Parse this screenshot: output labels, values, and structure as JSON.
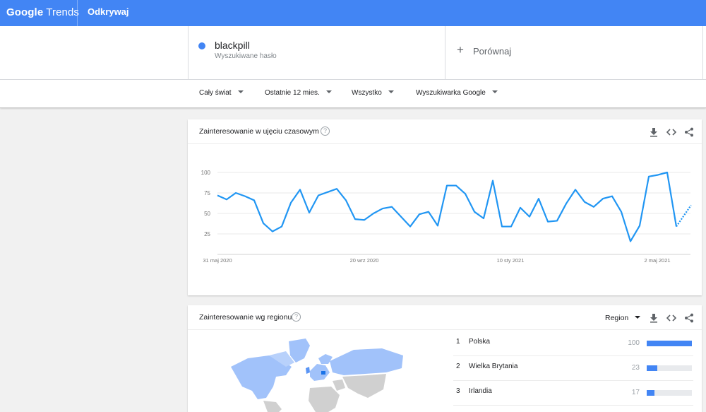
{
  "header": {
    "logo_google": "Google",
    "logo_trends": "Trends",
    "nav_label": "Odkrywaj"
  },
  "search_term": {
    "name": "blackpill",
    "subtitle": "Wyszukiwane hasło",
    "color": "#4285f4"
  },
  "compare": {
    "icon": "plus-icon",
    "label": "Porównaj"
  },
  "filters": {
    "location": "Cały świat",
    "time_range": "Ostatnie 12 mies.",
    "category": "Wszystko",
    "source": "Wyszukiwarka Google"
  },
  "time_card": {
    "title": "Zainteresowanie w ujęciu czasowym",
    "help_icon": "help-icon",
    "tools": [
      "download-icon",
      "embed-icon",
      "share-icon"
    ]
  },
  "chart_data": {
    "type": "line",
    "ylim": [
      0,
      100
    ],
    "y_ticks": [
      25,
      50,
      75,
      100
    ],
    "x_tick_labels": [
      "31 maj 2020",
      "20 wrz 2020",
      "10 sty 2021",
      "2 maj 2021"
    ],
    "grid": true,
    "series": [
      {
        "color": "#2196f3",
        "values": [
          72,
          67,
          75,
          71,
          66,
          38,
          28,
          34,
          63,
          79,
          51,
          72,
          76,
          80,
          66,
          43,
          42,
          50,
          56,
          58,
          46,
          34,
          49,
          52,
          35,
          84,
          84,
          74,
          52,
          44,
          90,
          34,
          34,
          57,
          46,
          68,
          40,
          41,
          62,
          79,
          64,
          58,
          68,
          71,
          52,
          16,
          35,
          95,
          97,
          100,
          34
        ],
        "partial_values": [
          34,
          60
        ]
      }
    ]
  },
  "region_card": {
    "title": "Zainteresowanie wg regionu",
    "help_icon": "help-icon",
    "region_select": "Region",
    "tools": [
      "download-icon",
      "embed-icon",
      "share-icon"
    ],
    "rankings": [
      {
        "rank": "1",
        "country": "Polska",
        "value": 100
      },
      {
        "rank": "2",
        "country": "Wielka Brytania",
        "value": 23
      },
      {
        "rank": "3",
        "country": "Irlandia",
        "value": 17
      }
    ],
    "bar_color": "#4285f4"
  }
}
